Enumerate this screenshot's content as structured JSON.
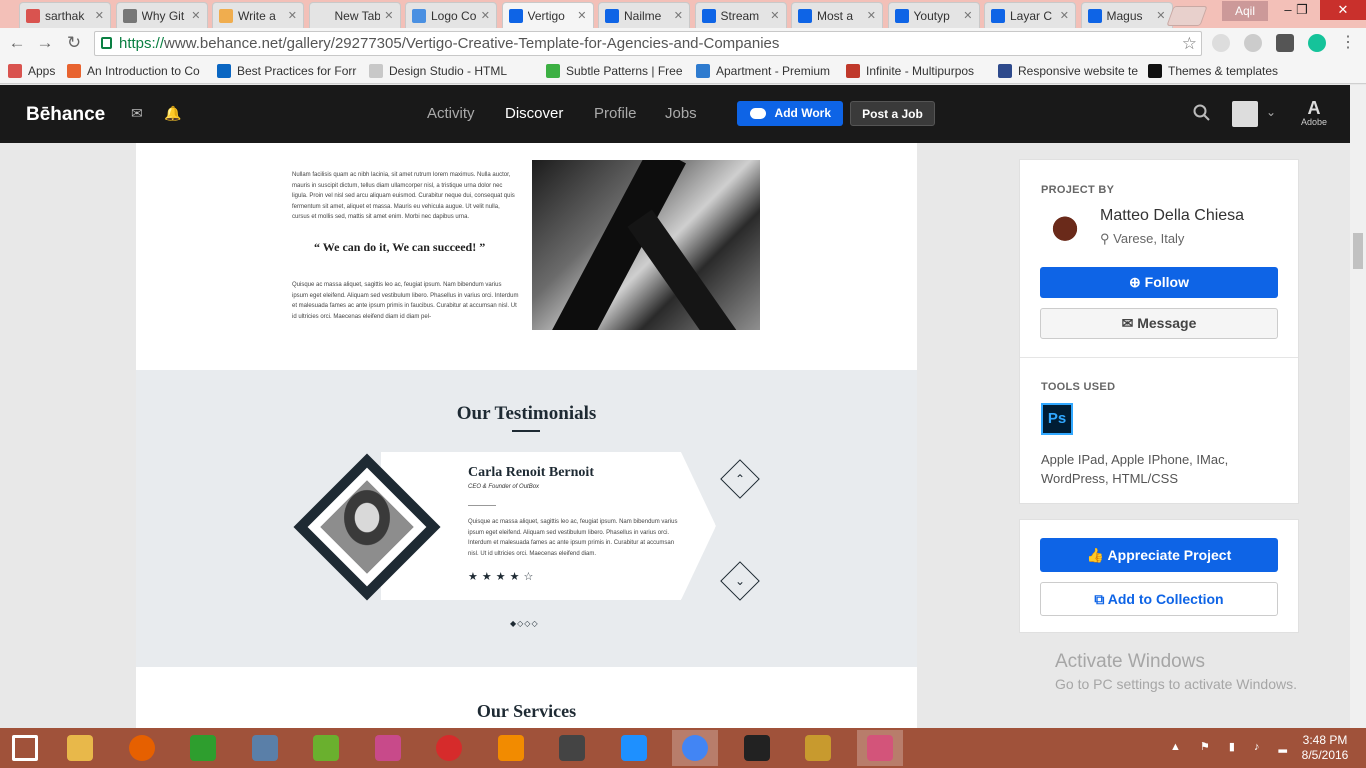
{
  "browser": {
    "tabs": [
      {
        "title": "sarthak",
        "color": "#d9534f",
        "icon": "hash-icon"
      },
      {
        "title": "Why Git",
        "color": "#777777",
        "icon": "database-icon"
      },
      {
        "title": "Write a",
        "color": "#f0ad4e",
        "icon": "x-icon"
      },
      {
        "title": "New Tab",
        "color": "#e4e4e4",
        "icon": ""
      },
      {
        "title": "Logo Co",
        "color": "#4a90e2",
        "icon": "loading-icon"
      },
      {
        "title": "Vertigo",
        "color": "#0e64e6",
        "icon": "behance-icon"
      },
      {
        "title": "Nailme",
        "color": "#0e64e6",
        "icon": "behance-icon"
      },
      {
        "title": "Stream",
        "color": "#0e64e6",
        "icon": "behance-icon"
      },
      {
        "title": "Most a",
        "color": "#0e64e6",
        "icon": "behance-icon"
      },
      {
        "title": "Youtyp",
        "color": "#0e64e6",
        "icon": "behance-icon"
      },
      {
        "title": "Layar C",
        "color": "#0e64e6",
        "icon": "behance-icon"
      },
      {
        "title": "Magus",
        "color": "#0e64e6",
        "icon": "behance-icon"
      }
    ],
    "user": "Aqil",
    "url_scheme": "https://",
    "url_rest": "www.behance.net/gallery/29277305/Vertigo-Creative-Template-for-Agencies-and-Companies",
    "bookmarks": [
      {
        "label": "Apps",
        "color": "#d9534f"
      },
      {
        "label": "An Introduction to Co",
        "color": "#e8632f"
      },
      {
        "label": "Best Practices for Forr",
        "color": "#0a66c2"
      },
      {
        "label": "Design Studio - HTML",
        "color": "#c8c8c8"
      },
      {
        "label": "Subtle Patterns | Free",
        "color": "#3cb043"
      },
      {
        "label": "Apartment - Premium",
        "color": "#2e7bcf"
      },
      {
        "label": "Infinite - Multipurpos",
        "color": "#c0392b"
      },
      {
        "label": "Responsive website te",
        "color": "#2e4a8c"
      },
      {
        "label": "Themes & templates",
        "color": "#111111"
      }
    ]
  },
  "behance": {
    "logo": "Bēhance",
    "nav": [
      "Activity",
      "Discover",
      "Profile",
      "Jobs"
    ],
    "active_nav": "Discover",
    "add_work": "Add Work",
    "post_job": "Post a Job",
    "adobe": "Adobe"
  },
  "project": {
    "intro1": "Nullam facilisis quam ac nibh lacinia, sit amet rutrum lorem maximus. Nulla auctor, mauris in suscipit dictum, tellus diam ullamcorper nisl, a tristique urna dolor nec ligula. Proin vel nisl sed arcu aliquam euismod. Curabitur neque dui, consequat quis fermentum sit amet, aliquet et massa. Mauris eu vehicula augue. Ut velit nulla, cursus et mollis sed, mattis sit amet enim. Morbi nec dapibus urna.",
    "quote": "“ We can do it, We can succeed! ”",
    "intro2": "Quisque ac massa aliquet, sagittis leo ac, feugiat ipsum. Nam bibendum varius ipsum eget eleifend. Aliquam sed vestibulum libero. Phasellus in varius orci. Interdum et malesuada fames ac ante ipsum primis in faucibus. Curabitur at accumsan nisl. Ut id ultricies orci. Maecenas eleifend diam id diam pel-",
    "testimonials_title": "Our Testimonials",
    "person_name": "Carla Renoit Bernoit",
    "person_role": "CEO & Founder of OutBox",
    "testimonial": "Quisque ac massa aliquet, sagittis leo ac, feugiat ipsum. Nam bibendum varius ipsum eget eleifend. Aliquam sed vestibulum libero. Phasellus in varius orci. Interdum et malesuada fames ac ante ipsum primis in. Curabitur at accumsan nisl. Ut id ultricies orci. Maecenas eleifend diam.",
    "stars": "★★★★☆",
    "rating": 4,
    "dots": "◆◇◇◇",
    "services_title": "Our Services"
  },
  "sidebar": {
    "project_by": "PROJECT BY",
    "owner": "Matteo Della Chiesa",
    "location": "Varese, Italy",
    "follow": "Follow",
    "message": "Message",
    "tools_used": "TOOLS USED",
    "ps": "Ps",
    "tools": "Apple IPad, Apple IPhone, IMac, WordPress, HTML/CSS",
    "appreciate": "Appreciate Project",
    "add_collection": "Add to Collection"
  },
  "watermark": {
    "line1": "Activate Windows",
    "line2": "Go to PC settings to activate Windows."
  },
  "taskbar": {
    "time": "3:48 PM",
    "date": "8/5/2016",
    "apps": [
      "windows-icon",
      "file-explorer-icon",
      "firefox-icon",
      "store-icon",
      "mail-icon",
      "frog-icon",
      "paint-icon",
      "opera-icon",
      "vlc-icon",
      "sublime-icon",
      "ie-icon",
      "chrome-icon",
      "terminal-icon",
      "stack-icon",
      "gitkraken-icon"
    ]
  }
}
